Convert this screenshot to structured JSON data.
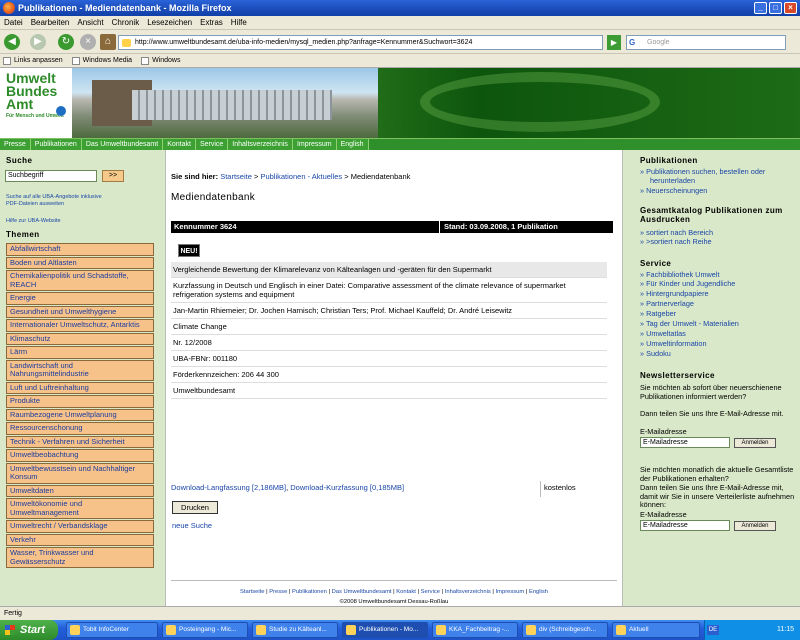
{
  "window": {
    "title": "Publikationen - Mediendatenbank - Mozilla Firefox"
  },
  "menu": [
    "Datei",
    "Bearbeiten",
    "Ansicht",
    "Chronik",
    "Lesezeichen",
    "Extras",
    "Hilfe"
  ],
  "toolbar": {
    "url": "http://www.umweltbundesamt.de/uba-info-medien/mysql_medien.php?anfrage=Kennummer&Suchwort=3624",
    "search_placeholder": "Google"
  },
  "bookmarks": [
    "Links anpassen",
    "Windows Media",
    "Windows"
  ],
  "site": {
    "logo_line1": "Umwelt",
    "logo_line2": "Bundes",
    "logo_line3": "Amt",
    "logo_sub": "Für Mensch und Umwelt",
    "topnav": [
      "Presse",
      "Publikationen",
      "Das Umweltbundesamt",
      "Kontakt",
      "Service",
      "Inhaltsverzeichnis",
      "Impressum",
      "English"
    ]
  },
  "left": {
    "search_title": "Suche",
    "search_value": "Suchbegriff",
    "search_btn": ">>",
    "search_all_line1": "Suche auf alle UBA-Angebote inklusive",
    "search_all_line2": "PDF-Dateien ausweiten",
    "help": "Hilfe zur UBA-Website",
    "themen_title": "Themen",
    "themen": [
      "Abfallwirtschaft",
      "Boden und Altlasten",
      "Chemikalienpolitik und Schadstoffe, REACH",
      "Energie",
      "Gesundheit und Umwelthygiene",
      "Internationaler Umweltschutz, Antarktis",
      "Klimaschutz",
      "Lärm",
      "Landwirtschaft und Nahrungsmittelindustrie",
      "Luft und Luftreinhaltung",
      "Produkte",
      "Raumbezogene Umweltplanung",
      "Ressourcenschonung",
      "Technik - Verfahren und Sicherheit",
      "Umweltbeobachtung",
      "Umweltbewusstsein und Nachhaltiger Konsum",
      "Umweltdaten",
      "Umweltökonomie und Umweltmanagement",
      "Umweltrecht / Verbandsklage",
      "Verkehr",
      "Wasser, Trinkwasser und Gewässerschutz"
    ]
  },
  "main": {
    "bc_label": "Sie sind hier:",
    "bc_1": "Startseite",
    "bc_sep1": " > ",
    "bc_2": "Publikationen - Aktuelles",
    "bc_sep2": " > ",
    "bc_3": "Mediendatenbank",
    "title": "Mediendatenbank",
    "kennummer": "Kennummer 3624",
    "stand": "Stand: 03.09.2008, 1 Publikation",
    "neu": "NEU!",
    "rows": [
      "Vergleichende Bewertung der Klimarelevanz von Kälteanlagen und -geräten für den Supermarkt",
      "Kurzfassung in Deutsch und Englisch in einer Datei: Comparative assessment of the climate relevance of supermarket refrigeration systems and equipment",
      "Jan-Martin Rhiemeier; Dr. Jochen Harnisch; Christian Ters; Prof. Michael Kauffeld; Dr. André Leisewitz",
      "Climate Change",
      "Nr. 12/2008",
      "UBA-FBNr: 001180",
      "Förderkennzeichen: 206 44 300",
      "Umweltbundesamt"
    ],
    "dl_lang": "Download-Langfassung [2,186MB]",
    "dl_sep": ", ",
    "dl_kurz": "Download-Kurzfassung [0,185MB]",
    "kostenlos": "kostenlos",
    "druck": "Drucken",
    "neue_suche": "neue Suche",
    "footer_links": [
      "Startseite",
      "Presse",
      "Publikationen",
      "Das Umweltbundesamt",
      "Kontakt",
      "Service",
      "Inhaltsverzeichnis",
      "Impressum",
      "English"
    ],
    "copyright": "©2008 Umweltbundesamt Dessau-Roßlau"
  },
  "right": {
    "pub_title": "Publikationen",
    "pub_links": [
      "Publikationen suchen, bestellen oder herunterladen",
      "Neuerscheinungen"
    ],
    "kat_title": "Gesamtkatalog Publikationen zum Ausdrucken",
    "kat_links": [
      "sortiert nach Bereich",
      ">sortiert nach Reihe"
    ],
    "service_title": "Service",
    "service_links": [
      "Fachbibliothek Umwelt",
      "Für Kinder und Jugendliche",
      "Hintergrundpapiere",
      "Partnerverlage",
      "Ratgeber",
      "Tag der Umwelt - Materialien",
      "Umweltatlas",
      "Umweltinformation",
      "Sudoku"
    ],
    "news_title": "Newsletterservice",
    "news_text1": "Sie möchten ab sofort über neuerschienene Publikationen informiert werden?",
    "news_text2": "Dann teilen Sie uns Ihre E-Mail-Adresse mit.",
    "email_label": "E-Mailadresse",
    "email_value": "E-Mailadresse",
    "anmelden": "Anmelden",
    "news_text3": "Sie möchten monatlich die aktuelle Gesamtliste der Publikationen erhalten?",
    "news_text4": "Dann teilen Sie uns Ihre E-Mail-Adresse mit, damit wir Sie in unsere Verteilerliste aufnehmen können:",
    "email_label2": "E-Mailadresse",
    "email_value2": "E-Mailadresse",
    "anmelden2": "Anmelden"
  },
  "status": "Fertig",
  "taskbar": {
    "start": "Start",
    "tasks": [
      "Tobit InfoCenter",
      "Posteingang - Mic...",
      "Studie zu Kälteanl...",
      "Publikationen - Mo...",
      "KKA_Fachbeitrag -...",
      "div (Schreibgesch...",
      "Aktuell"
    ],
    "lang": "DE",
    "time": "11:15"
  }
}
